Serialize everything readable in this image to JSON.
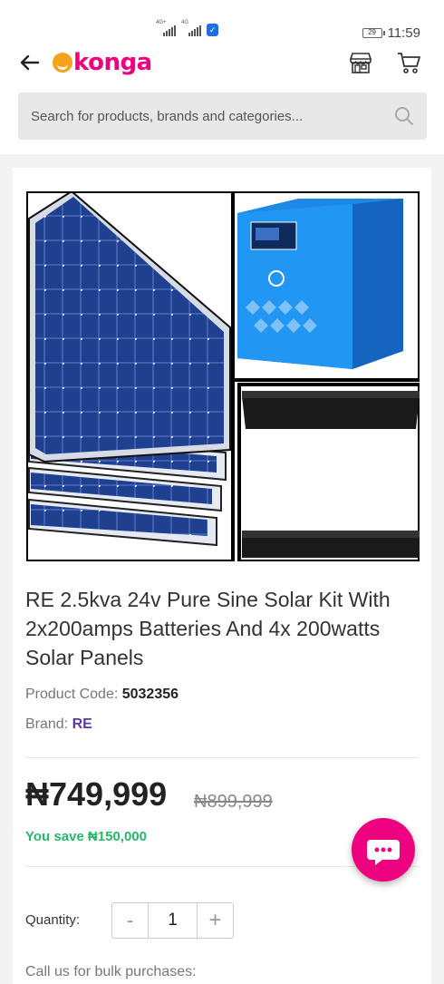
{
  "status_bar": {
    "signal_1_tag": "4G+",
    "signal_2_tag": "4G",
    "battery": "29",
    "time": "11:59"
  },
  "header": {
    "logo_text": "konga",
    "back_icon": "back-arrow-icon",
    "store_icon": "store-icon",
    "cart_icon": "cart-icon"
  },
  "search": {
    "placeholder": "Search for products, brands and categories..."
  },
  "product": {
    "title": "RE 2.5kva 24v Pure Sine Solar Kit With 2x200amps Batteries And 4x 200watts Solar Panels",
    "code_label": "Product Code:",
    "code_value": "5032356",
    "brand_label": "Brand:",
    "brand_value": "RE",
    "price": "₦749,999",
    "old_price": "₦899,999",
    "savings": "You save ₦150,000",
    "quantity_label": "Quantity:",
    "quantity_minus": "-",
    "quantity_value": "1",
    "quantity_plus": "+",
    "bulk_text": "Call us for bulk purchases:"
  },
  "colors": {
    "brand_pink": "#ed017f",
    "brand_orange": "#f7a21b",
    "brand_purple": "#5b3c9c",
    "savings_green": "#28b76b",
    "inverter_blue": "#1e88e5"
  }
}
